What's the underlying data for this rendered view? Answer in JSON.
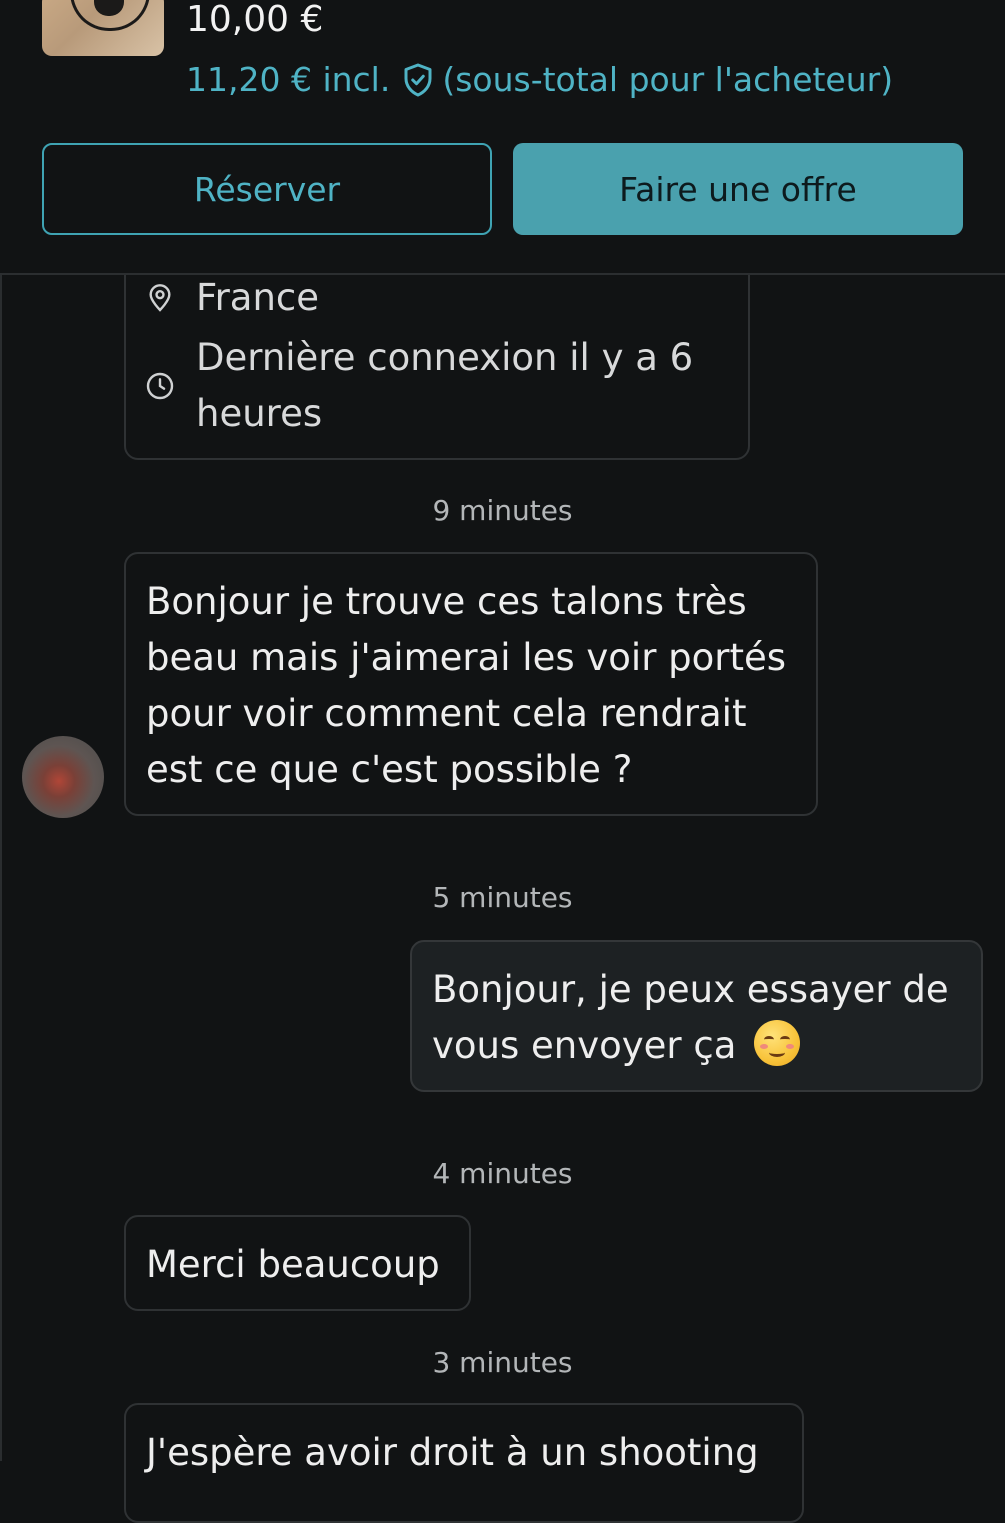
{
  "header": {
    "price": "10,00 €",
    "price_incl_prefix": "11,20 € incl.",
    "price_incl_suffix": "(sous-total pour l'acheteur)",
    "reserve_label": "Réserver",
    "offer_label": "Faire une offre",
    "accent_color": "#4aa1ae"
  },
  "profile": {
    "location": "France",
    "last_seen": "Dernière connexion il y a 6 heures"
  },
  "messages": [
    {
      "time": "9 minutes",
      "side": "in",
      "text": "Bonjour je trouve ces talons très beau mais j'aimerai les voir portés pour voir comment cela rendrait est ce que c'est possible ?"
    },
    {
      "time": "5 minutes",
      "side": "out",
      "text": "Bonjour, je peux essayer de vous envoyer ça",
      "emoji": "smiling-face-with-blush"
    },
    {
      "time": "4 minutes",
      "side": "in",
      "text": "Merci beaucoup"
    },
    {
      "time": "3 minutes",
      "side": "in",
      "text": "J'espère avoir droit à un shooting"
    }
  ]
}
